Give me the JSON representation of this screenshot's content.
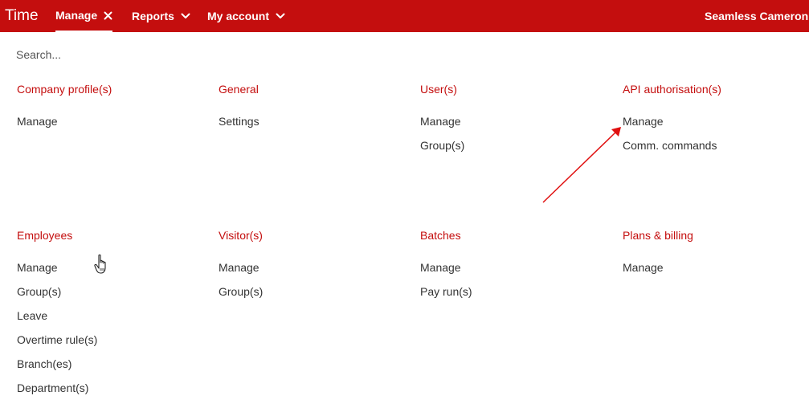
{
  "app": {
    "title": "Time"
  },
  "nav": {
    "manage": {
      "label": "Manage",
      "icon": "close-icon"
    },
    "reports": {
      "label": "Reports",
      "icon": "chevron-down-icon"
    },
    "account": {
      "label": "My account",
      "icon": "chevron-down-icon"
    },
    "user": "Seamless Cameron Pl"
  },
  "search": {
    "placeholder": "Search..."
  },
  "sections": [
    {
      "title": "Company profile(s)",
      "links": [
        "Manage"
      ]
    },
    {
      "title": "General",
      "links": [
        "Settings"
      ]
    },
    {
      "title": "User(s)",
      "links": [
        "Manage",
        "Group(s)"
      ]
    },
    {
      "title": "API authorisation(s)",
      "links": [
        "Manage",
        "Comm. commands"
      ]
    },
    {
      "title": "Employees",
      "links": [
        "Manage",
        "Group(s)",
        "Leave",
        "Overtime rule(s)",
        "Branch(es)",
        "Department(s)"
      ]
    },
    {
      "title": "Visitor(s)",
      "links": [
        "Manage",
        "Group(s)"
      ]
    },
    {
      "title": "Batches",
      "links": [
        "Manage",
        "Pay run(s)"
      ]
    },
    {
      "title": "Plans & billing",
      "links": [
        "Manage"
      ]
    }
  ],
  "colors": {
    "brand": "#c40e0e",
    "text": "#333333",
    "annotation": "#e01010"
  }
}
